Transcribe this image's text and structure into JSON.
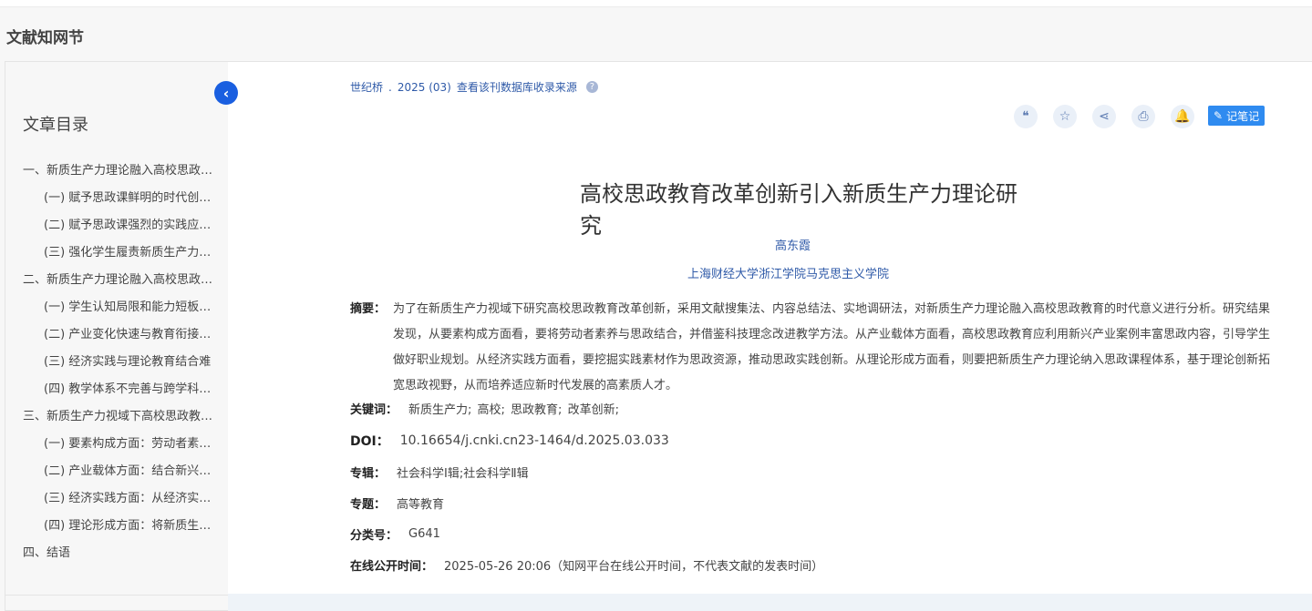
{
  "brand": "文献知网节",
  "toc": {
    "title": "文章目录",
    "items": [
      {
        "label": "一、新质生产力理论融入高校思政…",
        "level": 1
      },
      {
        "label": "(一) 赋予思政课鲜明的时代创…",
        "level": 2
      },
      {
        "label": "(二) 赋予思政课强烈的实践应…",
        "level": 2
      },
      {
        "label": "(三) 强化学生履责新质生产力…",
        "level": 2
      },
      {
        "label": "二、新质生产力理论融入高校思政…",
        "level": 1
      },
      {
        "label": "(一) 学生认知局限和能力短板…",
        "level": 2
      },
      {
        "label": "(二) 产业变化快速与教育衔接…",
        "level": 2
      },
      {
        "label": "(三) 经济实践与理论教育结合难",
        "level": 2
      },
      {
        "label": "(四) 教学体系不完善与跨学科…",
        "level": 2
      },
      {
        "label": "三、新质生产力视域下高校思政教…",
        "level": 1
      },
      {
        "label": "(一) 要素构成方面：劳动者素…",
        "level": 2
      },
      {
        "label": "(二) 产业载体方面：结合新兴…",
        "level": 2
      },
      {
        "label": "(三) 经济实践方面：从经济实…",
        "level": 2
      },
      {
        "label": "(四) 理论形成方面：将新质生…",
        "level": 2
      },
      {
        "label": "四、结语",
        "level": 1
      }
    ]
  },
  "source": {
    "journal": "世纪桥",
    "issue": "2025 (03)",
    "link": "查看该刊数据库收录来源"
  },
  "toolbar": {
    "icons": [
      "quote-icon",
      "star-icon",
      "share-icon",
      "print-icon",
      "bell-icon"
    ],
    "note_label": "记笔记"
  },
  "article": {
    "title": "高校思政教育改革创新引入新质生产力理论研究",
    "author": "高东霞",
    "affiliation": "上海财经大学浙江学院马克思主义学院",
    "abstract_label": "摘要：",
    "abstract": "为了在新质生产力视域下研究高校思政教育改革创新，采用文献搜集法、内容总结法、实地调研法，对新质生产力理论融入高校思政教育的时代意义进行分析。研究结果发现，从要素构成方面看，要将劳动者素养与思政结合，并借鉴科技理念改进教学方法。从产业载体方面看，高校思政教育应利用新兴产业案例丰富思政内容，引导学生做好职业规划。从经济实践方面看，要挖掘实践素材作为思政资源，推动思政实践创新。从理论形成方面看，则要把新质生产力理论纳入思政课程体系，基于理论创新拓宽思政视野，从而培养适应新时代发展的高素质人才。",
    "keywords_label": "关键词：",
    "keywords": [
      "新质生产力;",
      "高校;",
      "思政教育;",
      "改革创新;"
    ],
    "doi_label": "DOI：",
    "doi": "10.16654/j.cnki.cn23-1464/d.2025.03.033",
    "series_label": "专辑：",
    "series": "社会科学Ⅰ辑;社会科学Ⅱ辑",
    "topic_label": "专题：",
    "topic": "高等教育",
    "class_label": "分类号：",
    "class": "G641",
    "online_label": "在线公开时间：",
    "online": "2025-05-26 20:06（知网平台在线公开时间，不代表文献的发表时间）"
  }
}
